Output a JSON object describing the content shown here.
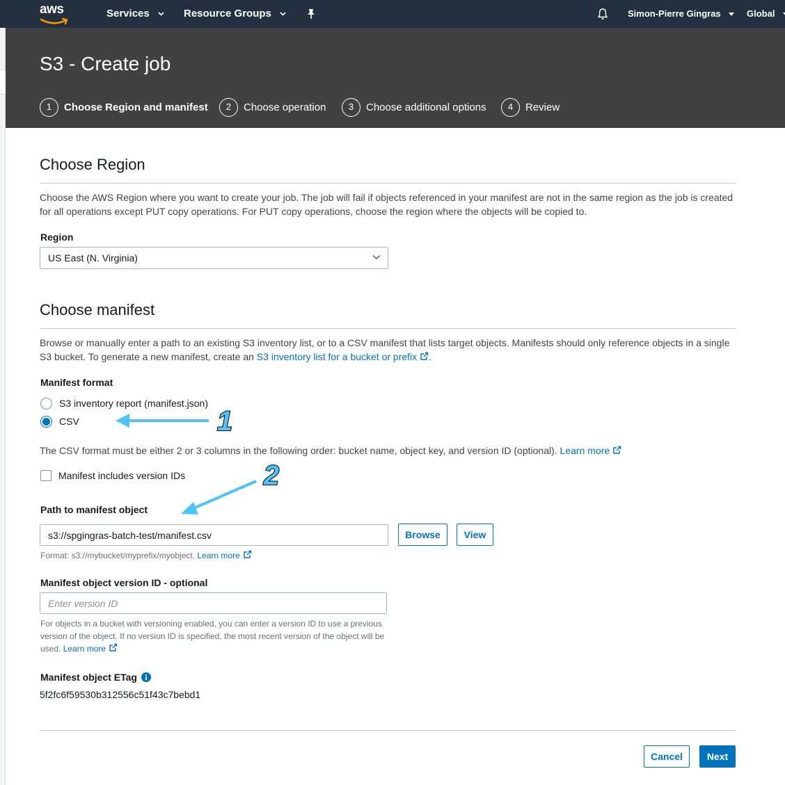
{
  "nav": {
    "logo": "aws",
    "services": "Services",
    "resource_groups": "Resource Groups",
    "user": "Simon-Pierre Gingras",
    "region": "Global"
  },
  "header": {
    "title": "S3 - Create job",
    "steps": [
      {
        "num": "1",
        "label": "Choose Region and manifest"
      },
      {
        "num": "2",
        "label": "Choose operation"
      },
      {
        "num": "3",
        "label": "Choose additional options"
      },
      {
        "num": "4",
        "label": "Review"
      }
    ]
  },
  "region_section": {
    "title": "Choose Region",
    "desc": "Choose the AWS Region where you want to create your job. The job will fail if objects referenced in your manifest are not in the same region as the job is created for all operations except PUT copy operations. For PUT copy operations, choose the region where the objects will be copied to.",
    "region_label": "Region",
    "region_value": "US East (N. Virginia)"
  },
  "manifest_section": {
    "title": "Choose manifest",
    "desc_pre": "Browse or manually enter a path to an existing S3 inventory list, or to a CSV manifest that lists target objects. Manifests should only reference objects in a single S3 bucket. To generate a new manifest, create an ",
    "desc_link": "S3 inventory list for a bucket or prefix",
    "desc_post": ".",
    "format_label": "Manifest format",
    "option_inventory": "S3 inventory report (manifest.json)",
    "option_csv": "CSV",
    "csv_note": "The CSV format must be either 2 or 3 columns in the following order: bucket name, object key, and version ID (optional).",
    "learn_more": "Learn more",
    "version_ids_label": "Manifest includes version IDs",
    "path_label": "Path to manifest object",
    "path_value": "s3://spgingras-batch-test/manifest.csv",
    "browse": "Browse",
    "view": "View",
    "path_hint": "Format: s3://mybucket/myprefix/myobject.",
    "version_label": "Manifest object version ID - optional",
    "version_placeholder": "Enter version ID",
    "version_hint": "For objects in a bucket with versioning enabled, you can enter a version ID to use a previous version of the object. If no version ID is specified, the most recent version of the object will be used.",
    "etag_label": "Manifest object ETag",
    "etag_value": "5f2fc6f59530b312556c51f43c7bebd1"
  },
  "footer": {
    "cancel": "Cancel",
    "next": "Next"
  },
  "annotations": {
    "one": "1",
    "two": "2"
  },
  "colors": {
    "nav_bg": "#232f3e",
    "header_bg": "#414141",
    "link": "#0073bb",
    "annotation": "#4fc3f7"
  }
}
